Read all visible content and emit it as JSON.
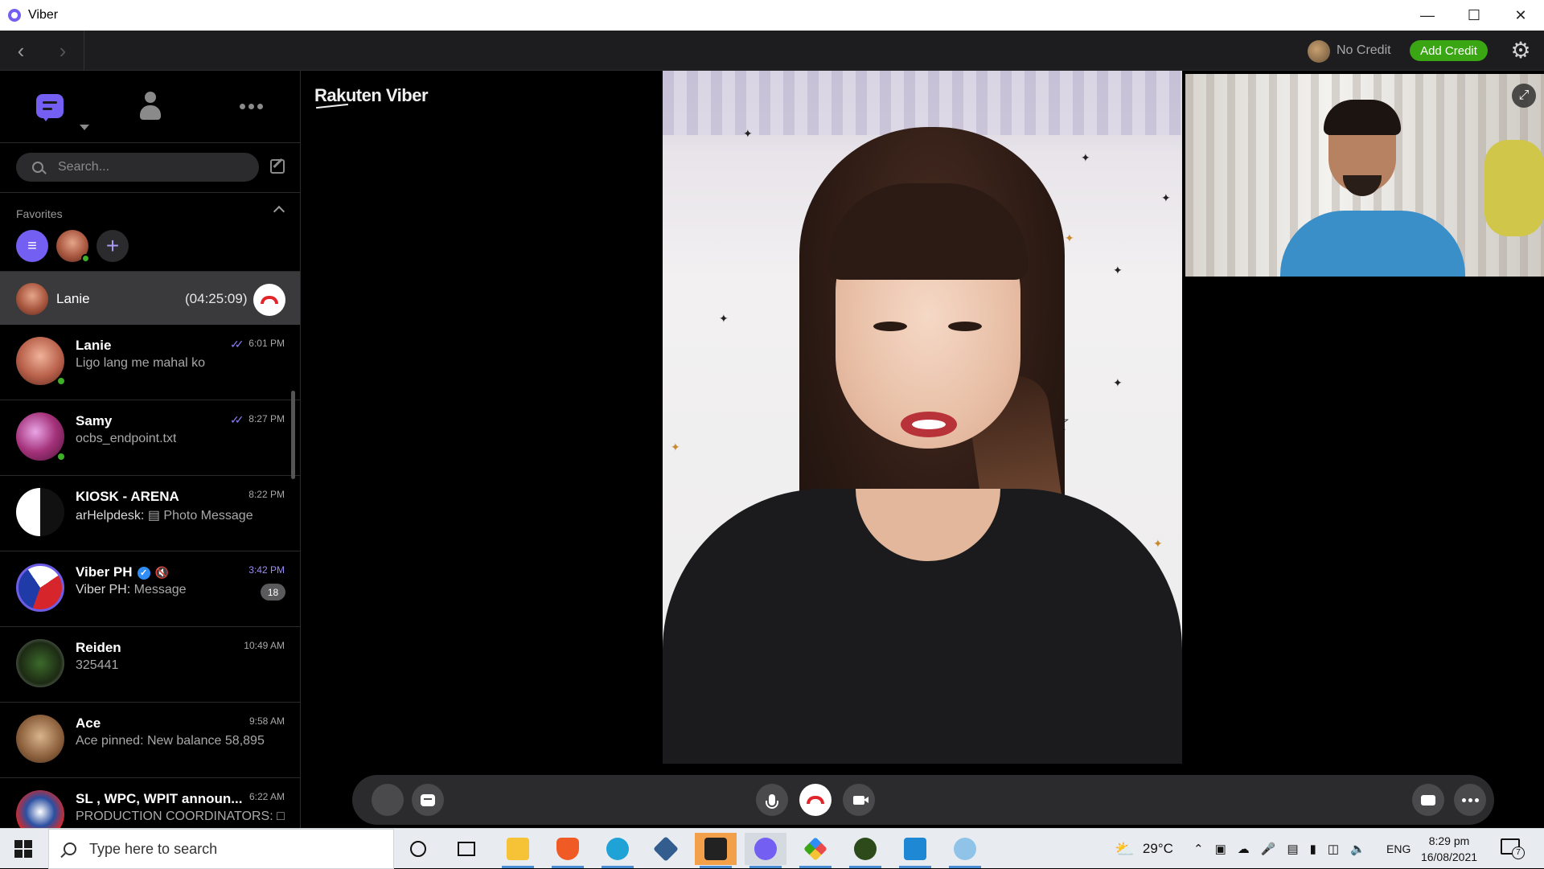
{
  "window": {
    "title": "Viber"
  },
  "toolbar": {
    "credit_text": "No Credit",
    "add_credit_label": "Add Credit"
  },
  "sidebar": {
    "search_placeholder": "Search...",
    "favorites_label": "Favorites",
    "active_call": {
      "name": "Lanie",
      "duration": "(04:25:09)"
    },
    "chats": [
      {
        "name": "Lanie",
        "preview": "Ligo lang me mahal ko",
        "time": "6:01 PM",
        "read": true,
        "online": true
      },
      {
        "name": "Samy",
        "preview": "ocbs_endpoint.txt",
        "time": "8:27 PM",
        "read": true,
        "online": true
      },
      {
        "name": "KIOSK - ARENA",
        "sender": "arHelpdesk:",
        "preview": "Photo Message",
        "time": "8:22 PM"
      },
      {
        "name": "Viber PH",
        "sender": "Viber PH:",
        "preview": "Message",
        "time": "3:42 PM",
        "badge": "18",
        "verified": true,
        "muted": true
      },
      {
        "name": "Reiden",
        "preview": "325441",
        "time": "10:49 AM"
      },
      {
        "name": "Ace",
        "preview": "Ace pinned: New balance 58,895",
        "time": "9:58 AM"
      },
      {
        "name": "SL , WPC, WPIT announ...",
        "preview": "PRODUCTION COORDINATORS:",
        "time": "6:22 AM"
      }
    ]
  },
  "main": {
    "brand": "Rakuten Viber"
  },
  "colors": {
    "viber_purple": "#7360f2",
    "add_credit_green": "#3aa614",
    "hangup_red": "#e0262b",
    "online_green": "#3fae29"
  },
  "icons": {
    "call_bar": [
      "participants-icon",
      "chat-icon",
      "mic-icon",
      "end-call-icon",
      "camera-icon",
      "screen-share-icon",
      "more-icon"
    ]
  },
  "taskbar": {
    "search_placeholder": "Type here to search",
    "weather": "29°C",
    "language": "ENG",
    "time": "8:29 pm",
    "date": "16/08/2021",
    "notification_count": "7"
  }
}
